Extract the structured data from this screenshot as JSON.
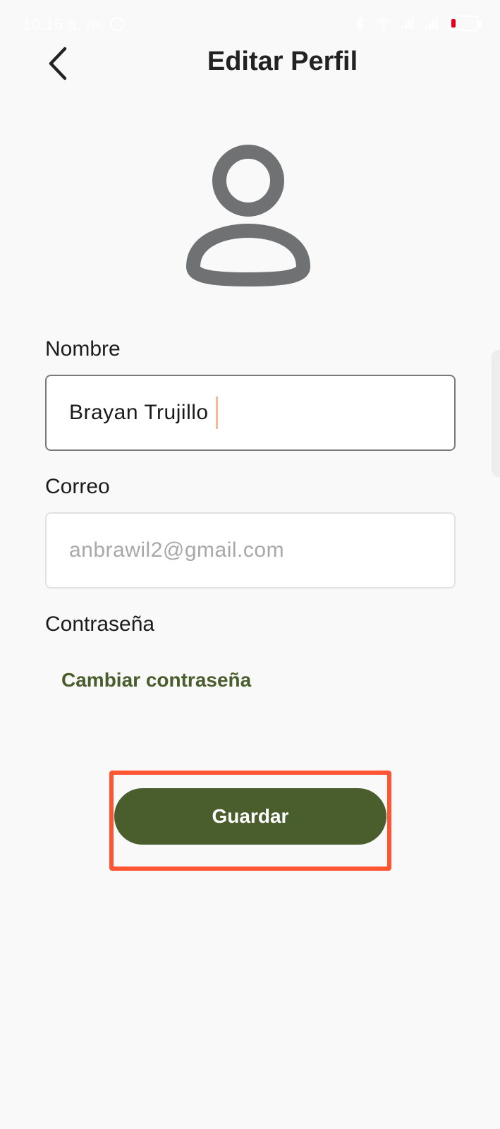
{
  "status_bar": {
    "time": "10:16 a. m.",
    "icons": [
      "bluetooth-icon",
      "wifi-icon",
      "signal-icon",
      "signal-icon",
      "battery-icon"
    ],
    "battery_color": "#e0001b"
  },
  "header": {
    "title": "Editar Perfil",
    "back_icon": "chevron-left-icon"
  },
  "avatar": {
    "icon": "user-icon",
    "color": "#6f7173"
  },
  "form": {
    "name": {
      "label": "Nombre",
      "value": "Brayan Trujillo"
    },
    "email": {
      "label": "Correo",
      "placeholder": "anbrawil2@gmail.com"
    },
    "password": {
      "label": "Contraseña",
      "link": "Cambiar contraseña"
    }
  },
  "actions": {
    "save_label": "Guardar"
  },
  "colors": {
    "accent": "#4a5e2d",
    "highlight": "#ff5533",
    "background": "#f9f9f9"
  }
}
